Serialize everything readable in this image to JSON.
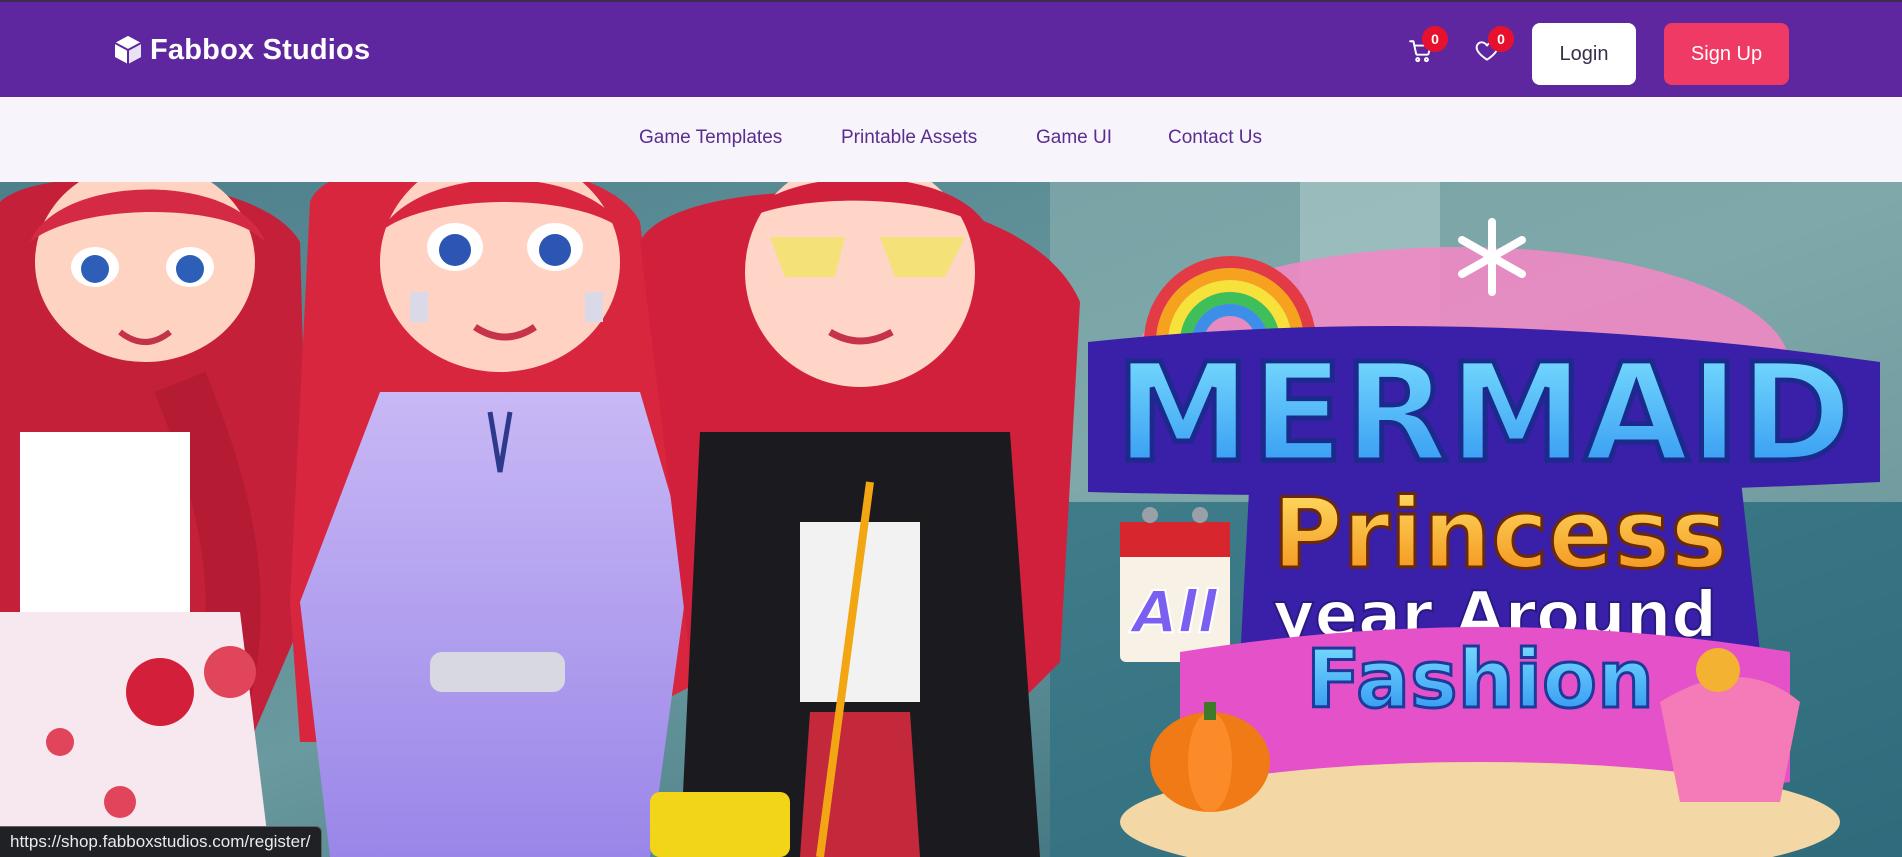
{
  "header": {
    "brand": "Fabbox Studios",
    "cart_count": "0",
    "wishlist_count": "0",
    "login_label": "Login",
    "signup_label": "Sign Up",
    "colors": {
      "bar": "#5e27a0",
      "signup": "#ee3a64",
      "badge": "#e8112d"
    }
  },
  "nav": {
    "items": [
      "Game Templates",
      "Printable Assets",
      "Game UI",
      "Contact Us"
    ]
  },
  "hero": {
    "title_line1": "MERMAID",
    "title_line2": "Princess",
    "title_line3a": "All",
    "title_line3b": "year Around",
    "title_line4": "Fashion"
  },
  "status": {
    "url": "https://shop.fabboxstudios.com/register/"
  },
  "icons": [
    "logo-cube-icon",
    "cart-icon",
    "heart-icon",
    "rainbow-icon",
    "snowflake-icon",
    "calendar-icon",
    "pumpkin-icon",
    "shell-icon"
  ]
}
